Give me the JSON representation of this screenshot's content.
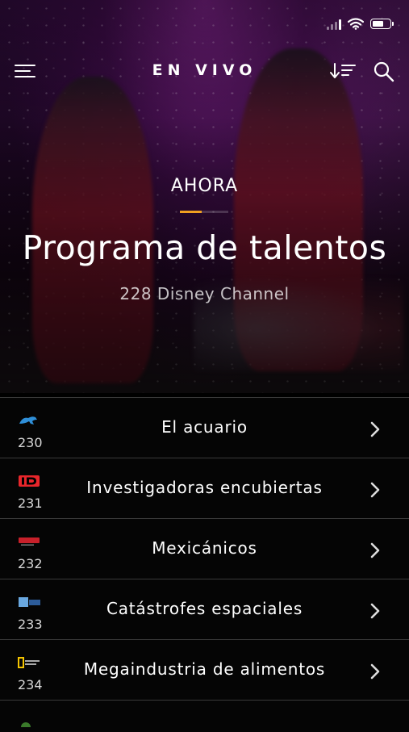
{
  "header": {
    "title": "EN VIVO",
    "menu_icon": "hamburger-menu-icon",
    "sort_icon": "sort-icon",
    "search_icon": "search-icon"
  },
  "status_bar": {
    "icons": [
      "cellular-signal-icon",
      "wifi-icon",
      "battery-icon"
    ]
  },
  "now_playing": {
    "label": "AHORA",
    "progress": 0.45,
    "title": "Programa de talentos",
    "channel": "228 Disney Channel",
    "progress_color": "#f0a020"
  },
  "channels": [
    {
      "number": "230",
      "program": "El acuario",
      "logo_icon": "animal-planet-logo-icon"
    },
    {
      "number": "231",
      "program": "Investigadoras encubiertas",
      "logo_icon": "id-logo-icon"
    },
    {
      "number": "232",
      "program": "Mexicánicos",
      "logo_icon": "discovery-turbo-logo-icon"
    },
    {
      "number": "233",
      "program": "Catástrofes espaciales",
      "logo_icon": "discovery-science-logo-icon"
    },
    {
      "number": "234",
      "program": "Megaindustria de alimentos",
      "logo_icon": "national-geographic-logo-icon"
    }
  ]
}
